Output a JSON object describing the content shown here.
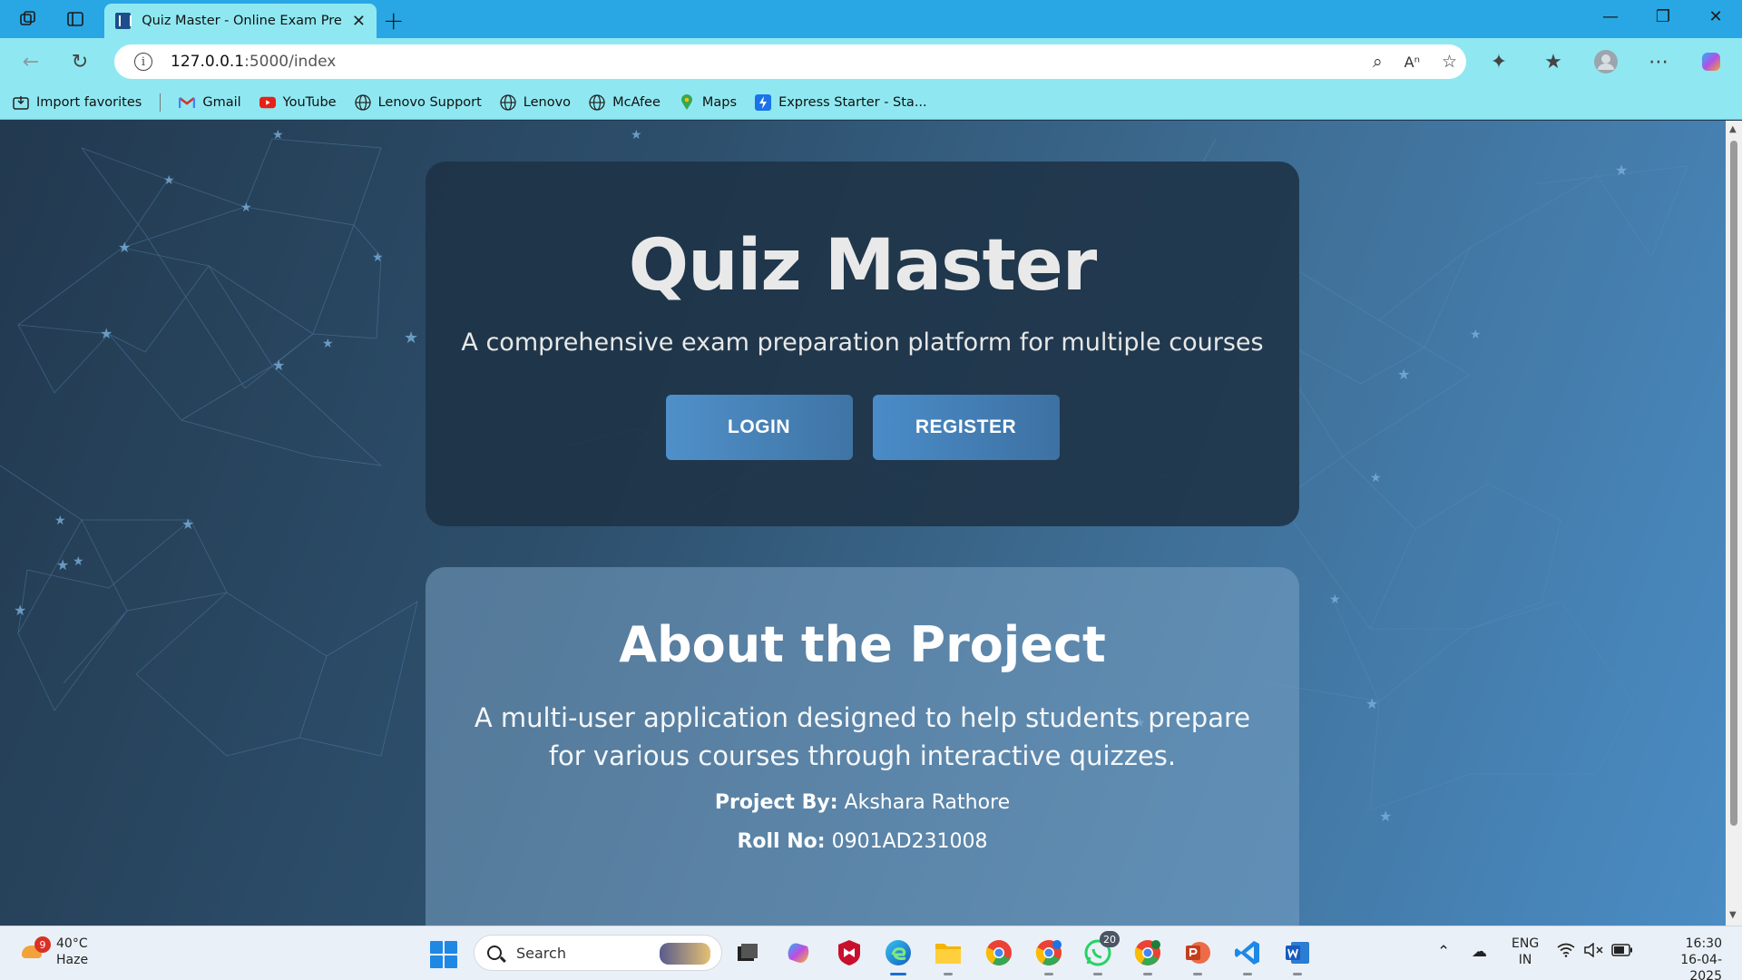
{
  "browser": {
    "tab_title": "Quiz Master - Online Exam Preparation",
    "tab_close": "✕",
    "new_tab": "+",
    "url_host": "127.0.0.1",
    "url_path": ":5000/index",
    "favorites": [
      {
        "label": "Import favorites",
        "icon": "import-icon"
      },
      {
        "label": "Gmail",
        "icon": "gmail-icon"
      },
      {
        "label": "YouTube",
        "icon": "youtube-icon"
      },
      {
        "label": "Lenovo Support",
        "icon": "globe-icon"
      },
      {
        "label": "Lenovo",
        "icon": "globe-icon"
      },
      {
        "label": "McAfee",
        "icon": "globe-icon"
      },
      {
        "label": "Maps",
        "icon": "maps-icon"
      },
      {
        "label": "Express Starter - Sta...",
        "icon": "express-icon"
      }
    ]
  },
  "hero": {
    "title": "Quiz Master",
    "subtitle": "A comprehensive exam preparation platform for multiple courses",
    "login_label": "LOGIN",
    "register_label": "REGISTER"
  },
  "about": {
    "title": "About the Project",
    "description": "A multi-user application designed to help students prepare for various courses through interactive quizzes.",
    "project_by_label": "Project By:",
    "project_by_value": "Akshara Rathore",
    "roll_label": "Roll No:",
    "roll_value": "0901AD231008"
  },
  "taskbar": {
    "weather_badge": "9",
    "temperature": "40°C",
    "condition": "Haze",
    "search_placeholder": "Search",
    "whatsapp_badge": "20",
    "language": "ENG",
    "region": "IN",
    "time": "16:30",
    "date": "16-04-2025"
  },
  "colors": {
    "browser_chrome": "#8fe8f1",
    "title_bar": "#28a7e4",
    "hero_card": "#1e3246",
    "button": "#4f90c9"
  }
}
